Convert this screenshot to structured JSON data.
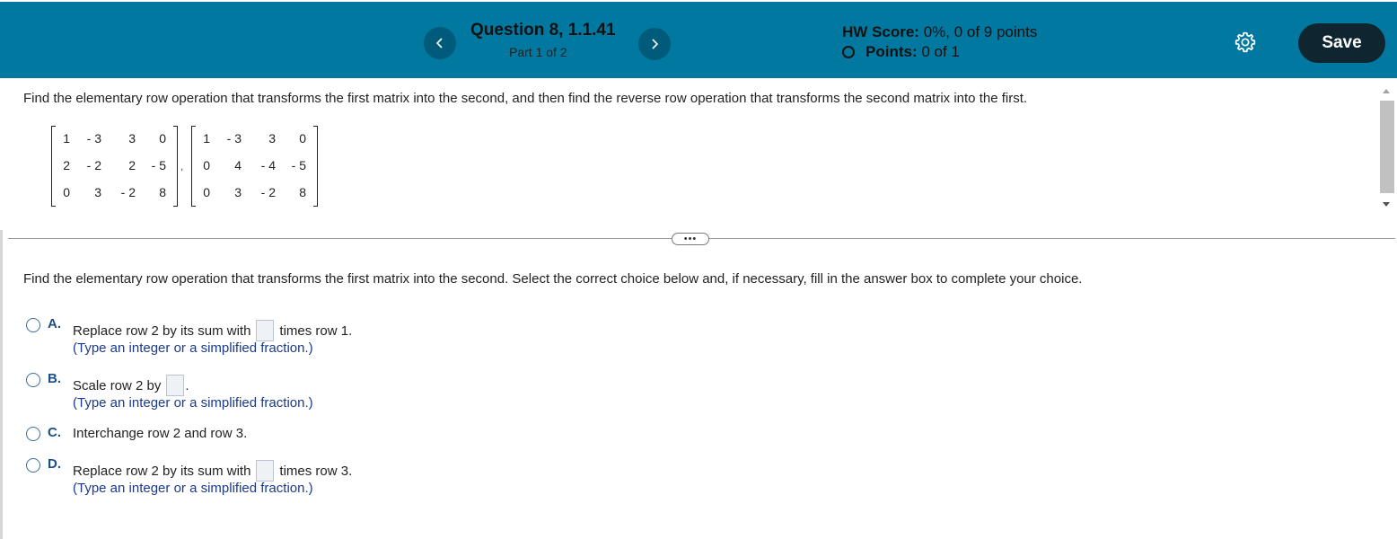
{
  "header": {
    "question_title": "Question 8, 1.1.41",
    "part": "Part 1 of 2",
    "hw_score_label": "HW Score:",
    "hw_score_value": "0%, 0 of 9 points",
    "points_label": "Points:",
    "points_value": "0 of 1",
    "save_label": "Save",
    "prev_icon": "chevron-left-icon",
    "next_icon": "chevron-right-icon",
    "settings_icon": "gear-icon",
    "header_color": "#00789f",
    "save_color": "#0f2530"
  },
  "question": {
    "statement": "Find the elementary row operation that transforms the first matrix into the second, and then find the reverse row operation that transforms the second matrix into the first.",
    "separator": ",",
    "matrix1": [
      [
        "1",
        "- 3",
        "3",
        "0"
      ],
      [
        "2",
        "- 2",
        "2",
        "- 5"
      ],
      [
        "0",
        "3",
        "- 2",
        "8"
      ]
    ],
    "matrix2": [
      [
        "1",
        "- 3",
        "3",
        "0"
      ],
      [
        "0",
        "4",
        "- 4",
        "- 5"
      ],
      [
        "0",
        "3",
        "- 2",
        "8"
      ]
    ]
  },
  "more_label": "•••",
  "answer": {
    "instruction": "Find the elementary row operation that transforms the first matrix into the second. Select the correct choice below and, if necessary, fill in the answer box to complete your choice.",
    "choices": [
      {
        "letter": "A.",
        "before": "Replace row 2 by its sum with",
        "after": "times row 1.",
        "hint": "(Type an integer or a simplified fraction.)"
      },
      {
        "letter": "B.",
        "before": "Scale row 2 by",
        "after": ".",
        "hint": "(Type an integer or a simplified fraction.)"
      },
      {
        "letter": "C.",
        "text": "Interchange row 2 and row 3."
      },
      {
        "letter": "D.",
        "before": "Replace row 2 by its sum with",
        "after": "times row 3.",
        "hint": "(Type an integer or a simplified fraction.)"
      }
    ]
  }
}
